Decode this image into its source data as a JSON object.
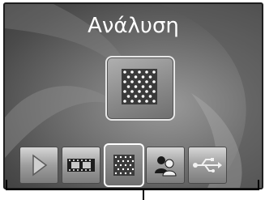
{
  "screen": {
    "title": "Ανάλυση"
  },
  "preview": {
    "icon": "resolution-dots-icon"
  },
  "menu": {
    "items": [
      {
        "icon": "play-triangle-icon",
        "selected": false
      },
      {
        "icon": "film-strip-icon",
        "selected": false
      },
      {
        "icon": "resolution-dots-icon",
        "selected": true
      },
      {
        "icon": "people-icon",
        "selected": false
      },
      {
        "icon": "usb-icon",
        "selected": false
      }
    ]
  },
  "colors": {
    "text": "#ffffff",
    "background": "#6d6d6d",
    "selection_border": "#ffffff"
  }
}
